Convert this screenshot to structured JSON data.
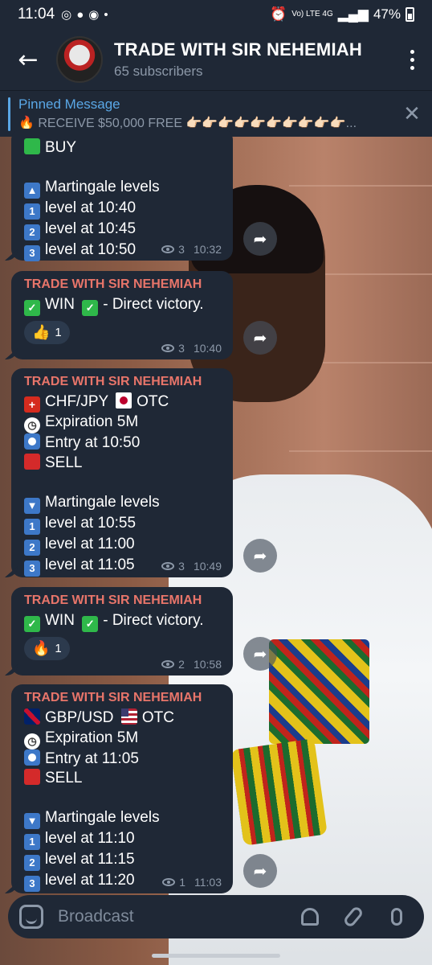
{
  "status_bar": {
    "time": "11:04",
    "network": "Vo) LTE 4G",
    "battery": "47%"
  },
  "header": {
    "title": "TRADE WITH SIR NEHEMIAH",
    "subtitle": "65 subscribers"
  },
  "pinned": {
    "label": "Pinned Message",
    "text": "🔥 RECEIVE $50,000 FREE 👉🏻👉🏻👉🏻👉🏻👉🏻👉🏻👉🏻👉🏻👉🏻👉🏻..."
  },
  "messages": [
    {
      "lines": [
        "BUY",
        "",
        "Martingale levels",
        "level at 10:40",
        "level at 10:45",
        "level at 10:50"
      ],
      "views": "3",
      "time": "10:32"
    },
    {
      "sender": "TRADE WITH SIR NEHEMIAH",
      "text_pre": "WIN",
      "text_post": "- Direct victory.",
      "reaction": {
        "emoji": "👍",
        "count": "1"
      },
      "views": "3",
      "time": "10:40"
    },
    {
      "sender": "TRADE WITH SIR NEHEMIAH",
      "pair": "CHF/JPY",
      "market": "OTC",
      "expiration": "Expiration 5M",
      "entry": "Entry at 10:50",
      "direction": "SELL",
      "martingale": "Martingale levels",
      "levels": [
        "level at 10:55",
        "level at 11:00",
        "level at 11:05"
      ],
      "views": "3",
      "time": "10:49"
    },
    {
      "sender": "TRADE WITH SIR NEHEMIAH",
      "text_pre": "WIN",
      "text_post": "- Direct victory.",
      "reaction": {
        "emoji": "🔥",
        "count": "1"
      },
      "views": "2",
      "time": "10:58"
    },
    {
      "sender": "TRADE WITH SIR NEHEMIAH",
      "pair": "GBP/USD",
      "market": "OTC",
      "expiration": "Expiration 5M",
      "entry": "Entry at 11:05",
      "direction": "SELL",
      "martingale": "Martingale levels",
      "levels": [
        "level at 11:10",
        "level at 11:15",
        "level at 11:20"
      ],
      "views": "1",
      "time": "11:03"
    }
  ],
  "input": {
    "placeholder": "Broadcast"
  },
  "icons": {
    "back": "arrow-left-icon",
    "menu": "more-vert-icon",
    "close": "close-icon",
    "share": "share-arrow-icon",
    "sticker": "sticker-icon",
    "bell": "bell-icon",
    "attach": "paperclip-icon",
    "mic": "microphone-icon"
  },
  "colors": {
    "header_bg": "#1f2836",
    "bubble_bg": "#1f2836",
    "sender": "#e8756a",
    "accent": "#5aa7e6",
    "meta": "#8c98a8"
  }
}
